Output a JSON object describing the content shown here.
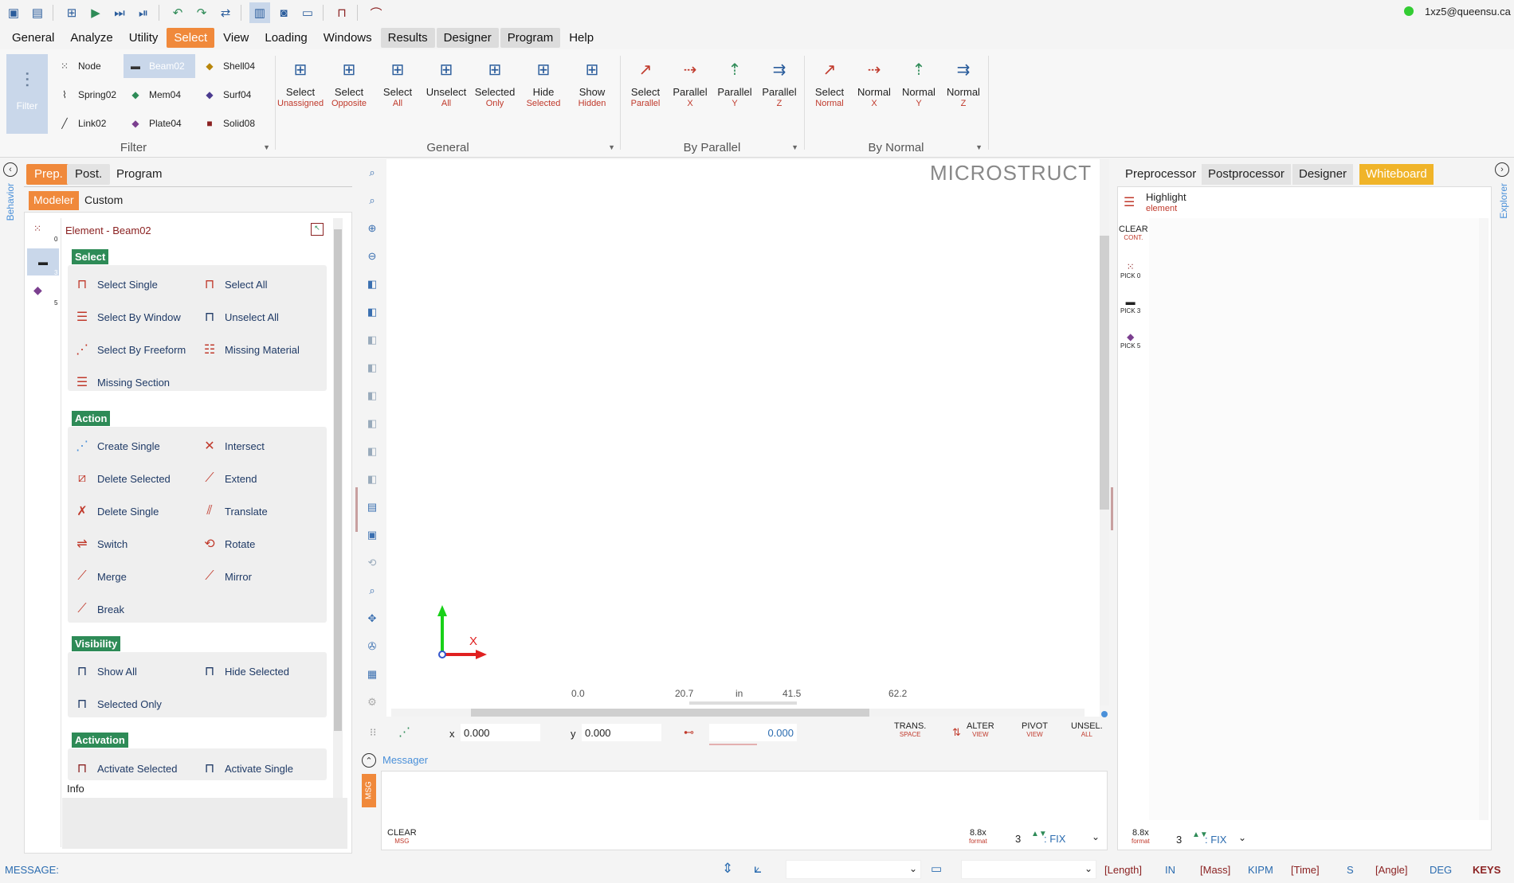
{
  "user": "1xz5@queensu.ca",
  "colors": {
    "accent": "#f0893b",
    "section": "#2e8b57",
    "link": "#1f3a66",
    "whiteboard": "#f0b429",
    "online": "#33cc33"
  },
  "menu": [
    "General",
    "Analyze",
    "Utility",
    "Select",
    "View",
    "Loading",
    "Windows",
    "Results",
    "Designer",
    "Program",
    "Help"
  ],
  "ribbon": {
    "filter": {
      "label": "Filter",
      "btn": "Filter",
      "items": [
        [
          "Node",
          "Beam02",
          "Shell04"
        ],
        [
          "Spring02",
          "Mem04",
          "Surf04"
        ],
        [
          "Link02",
          "Plate04",
          "Solid08"
        ]
      ]
    },
    "general": {
      "label": "General",
      "buttons": [
        [
          "Select",
          "Unassigned"
        ],
        [
          "Select",
          "Opposite"
        ],
        [
          "Select",
          "All"
        ],
        [
          "Unselect",
          "All"
        ],
        [
          "Selected",
          "Only"
        ],
        [
          "Hide",
          "Selected"
        ],
        [
          "Show",
          "Hidden"
        ]
      ]
    },
    "parallel": {
      "label": "By Parallel",
      "buttons": [
        [
          "Select",
          "Parallel"
        ],
        [
          "Parallel",
          "X"
        ],
        [
          "Parallel",
          "Y"
        ],
        [
          "Parallel",
          "Z"
        ]
      ]
    },
    "normal": {
      "label": "By Normal",
      "buttons": [
        [
          "Select",
          "Normal"
        ],
        [
          "Normal",
          "X"
        ],
        [
          "Normal",
          "Y"
        ],
        [
          "Normal",
          "Z"
        ]
      ]
    }
  },
  "left": {
    "tabs": [
      "Prep.",
      "Post.",
      "Program"
    ],
    "subtabs": [
      "Modeler",
      "Custom"
    ],
    "vertical_label": "Behavior",
    "element_title": "Element - Beam02",
    "counts": [
      "0",
      "3",
      "5"
    ],
    "sections": {
      "select": {
        "title": "Select",
        "items": [
          "Select Single",
          "Select All",
          "Select By Window",
          "Unselect All",
          "Select By Freeform",
          "Missing Material",
          "Missing Section"
        ]
      },
      "action": {
        "title": "Action",
        "items": [
          "Create Single",
          "Intersect",
          "Delete Selected",
          "Extend",
          "Delete Single",
          "Translate",
          "Switch",
          "Rotate",
          "Merge",
          "Mirror",
          "Break"
        ]
      },
      "visibility": {
        "title": "Visibility",
        "items": [
          "Show All",
          "Hide Selected",
          "Selected Only"
        ]
      },
      "activation": {
        "title": "Activation",
        "items": [
          "Activate Selected",
          "Activate Single"
        ]
      }
    },
    "info": "Info"
  },
  "canvas": {
    "brand": "MICROSTRUCT",
    "axis_x": "X",
    "ruler": [
      "0.0",
      "20.7",
      "in",
      "41.5",
      "62.2"
    ],
    "coord": {
      "x_label": "x",
      "x": "0.000",
      "y_label": "y",
      "y": "0.000",
      "d": "0.000"
    },
    "actions": [
      [
        "TRANS.",
        "SPACE"
      ],
      [
        "ALTER",
        "VIEW"
      ],
      [
        "PIVOT",
        "VIEW"
      ],
      [
        "UNSEL.",
        "ALL"
      ]
    ]
  },
  "messager": {
    "title": "Messager",
    "tab": "MSG",
    "clear": "CLEAR",
    "clear_sub": "MSG",
    "fmt": "8.8x",
    "fmt_sub": "format",
    "digits": "3",
    "mode": ": FIX"
  },
  "right": {
    "tabs": [
      "Preprocessor",
      "Postprocessor",
      "Designer",
      "Whiteboard"
    ],
    "vertical_label": "Explorer",
    "highlight": "Highlight",
    "highlight_sub": "element",
    "clear": "CLEAR",
    "clear_sub": "CONT.",
    "picks": [
      [
        "PICK",
        "0"
      ],
      [
        "PICK",
        "3"
      ],
      [
        "PICK",
        "5"
      ]
    ],
    "fmt": "8.8x",
    "fmt_sub": "format",
    "digits": "3",
    "mode": ": FIX"
  },
  "status": {
    "message": "MESSAGE:",
    "units": [
      [
        "[Length]",
        "IN"
      ],
      [
        "[Mass]",
        "KIPM"
      ],
      [
        "[Time]",
        "S"
      ],
      [
        "[Angle]",
        "DEG"
      ]
    ],
    "keys": "KEYS"
  }
}
